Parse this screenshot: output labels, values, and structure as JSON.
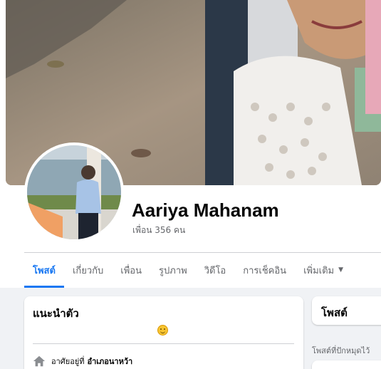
{
  "profile": {
    "name": "Aariya Mahanam",
    "friends_count": "เพื่อน 356 คน"
  },
  "tabs": [
    {
      "label": "โพสต์",
      "active": true
    },
    {
      "label": "เกี่ยวกับ"
    },
    {
      "label": "เพื่อน"
    },
    {
      "label": "รูปภาพ"
    },
    {
      "label": "วิดีโอ"
    },
    {
      "label": "การเช็คอิน"
    },
    {
      "label": "เพิ่มเติม"
    }
  ],
  "intro": {
    "title": "แนะนำตัว",
    "lives_in_label": "อาศัยอยู่ที่",
    "lives_in_value": "อำเภอนาหว้า"
  },
  "posts": {
    "title": "โพสต์",
    "pinned_label": "โพสต์ที่ปักหมุดไว้"
  },
  "colors": {
    "accent": "#1877f2",
    "secondary_text": "#65676b",
    "page_bg": "#f0f2f5"
  }
}
